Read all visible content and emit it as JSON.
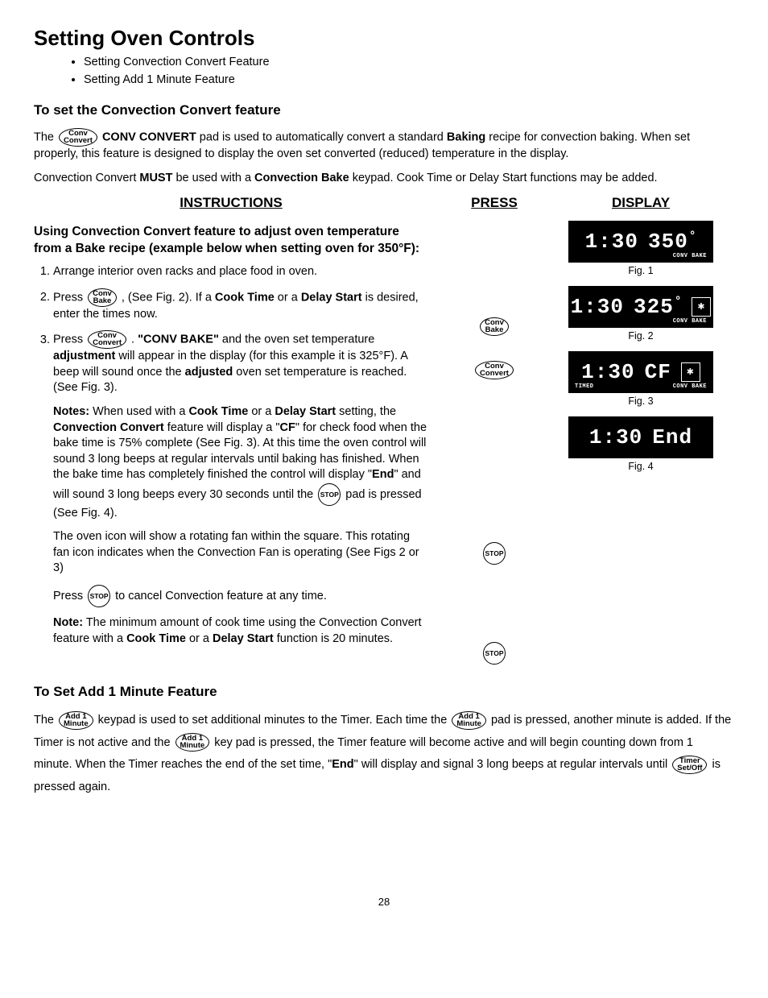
{
  "title": "Setting Oven Controls",
  "bullets": [
    "Setting Convection Convert Feature",
    "Setting Add 1 Minute Feature"
  ],
  "section1": {
    "heading": "To set the Convection Convert feature",
    "p1a": "The ",
    "p1b": " CONV CONVERT",
    "p1c": " pad is used to automatically convert a standard ",
    "p1d": "Baking",
    "p1e": " recipe for convection baking. When set properly, this feature is designed to display the oven set converted (reduced) temperature in the display.",
    "p2a": "Convection Convert ",
    "p2b": "MUST",
    "p2c": " be used with a ",
    "p2d": "Convection Bake",
    "p2e": " keypad. Cook Time or Delay Start functions may be added."
  },
  "cols": {
    "instructions": "INSTRUCTIONS",
    "press": "PRESS",
    "display": "DISPLAY"
  },
  "subhead": "Using Convection Convert feature to adjust oven temperature from a Bake recipe (example below when setting oven for 350°F):",
  "step1": "Arrange interior oven racks and place food in oven.",
  "step2": {
    "a": "Press ",
    "b": " , (See Fig. 2). If a ",
    "c": "Cook Time",
    "d": " or a ",
    "e": "Delay Start",
    "f": " is desired, enter the times now."
  },
  "step3": {
    "a": "Press ",
    "b": " . ",
    "c": "\"CONV BAKE\"",
    "d": " and the oven set temperature ",
    "e": "adjustment",
    "f": " will appear in the display (for this example it is 325°F). A beep will sound once the ",
    "g": "adjusted",
    "h": " oven set temperature is reached. (See Fig. 3).",
    "notes_a": "Notes:",
    "notes_b": " When used with a ",
    "notes_c": "Cook Time",
    "notes_d": " or a ",
    "notes_e": "Delay Start",
    "notes_f": " setting, the ",
    "notes_g": "Convection Convert",
    "notes_h": " feature will display a \"",
    "notes_i": "CF",
    "notes_j": "\" for check food when the bake time is 75% complete (See Fig. 3). At this time the oven control will sound 3 long beeps at regular intervals until baking has finished. When the bake time has completely finished the control will display \"",
    "notes_k": "End",
    "notes_l": "\" and will sound 3 long beeps every 30 seconds until the ",
    "notes_m": " pad is pressed (See Fig. 4).",
    "fan": "The oven icon will show a rotating fan within the square. This rotating fan icon indicates when the Convection Fan is operating (See Figs 2 or 3)",
    "cancel_a": "Press ",
    "cancel_b": " to cancel Convection feature at any time.",
    "note2_a": "Note:",
    "note2_b": " The minimum amount of cook time using the Convection Convert feature with a ",
    "note2_c": "Cook Time",
    "note2_d": " or a ",
    "note2_e": "Delay Start",
    "note2_f": " function is 20 minutes."
  },
  "pads": {
    "convConvert": {
      "top": "Conv",
      "bot": "Convert"
    },
    "convBake": {
      "top": "Conv",
      "bot": "Bake"
    },
    "stop": "STOP",
    "add1": {
      "top": "Add 1",
      "bot": "Minute"
    },
    "timer": {
      "top": "Timer",
      "bot": "Set/Off"
    }
  },
  "displays": {
    "fig1": {
      "time": "1:30",
      "val": "350",
      "label": "CONV BAKE",
      "caption": "Fig. 1"
    },
    "fig2": {
      "time": "1:30",
      "val": "325",
      "label": "CONV BAKE",
      "caption": "Fig. 2"
    },
    "fig3": {
      "time": "1:30",
      "val": "CF",
      "label": "CONV BAKE",
      "timed": "TIMED",
      "caption": "Fig. 3"
    },
    "fig4": {
      "time": "1:30",
      "val": "End",
      "caption": "Fig. 4"
    }
  },
  "section2": {
    "heading": "To Set Add 1 Minute Feature",
    "p1a": "The ",
    "p1b": " keypad is used to set additional minutes to the Timer. Each time the ",
    "p1c": " pad is pressed, another minute is added. If the Timer is not active and the ",
    "p1d": " key pad is pressed, the Timer feature will become active and will begin counting down from 1 minute. When the Timer reaches the end of the set time, \"",
    "p1e": "End",
    "p1f": "\" will display and signal 3 long beeps at regular intervals until ",
    "p1g": " is pressed again."
  },
  "pageNumber": "28"
}
